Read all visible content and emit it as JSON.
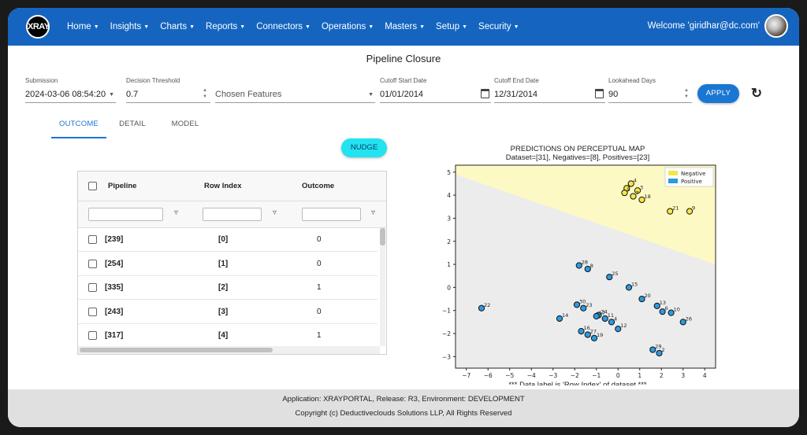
{
  "navbar": {
    "logo_text": "XRAY",
    "menu": [
      "Home",
      "Insights",
      "Charts",
      "Reports",
      "Connectors",
      "Operations",
      "Masters",
      "Setup",
      "Security"
    ],
    "welcome": "Welcome 'giridhar@dc.com'",
    "brand_color": "#1565c0"
  },
  "page": {
    "title": "Pipeline Closure"
  },
  "filters": {
    "submission": {
      "label": "Submission",
      "value": "2024-03-06 08:54:20"
    },
    "threshold": {
      "label": "Decision Threshold",
      "value": "0.7"
    },
    "features": {
      "placeholder": "Chosen Features"
    },
    "start_date": {
      "label": "Cutoff Start Date",
      "value": "01/01/2014"
    },
    "end_date": {
      "label": "Cutoff End Date",
      "value": "12/31/2014"
    },
    "lookahead": {
      "label": "Lookahead Days",
      "value": "90"
    },
    "apply_label": "APPLY"
  },
  "tabs": [
    {
      "label": "OUTCOME",
      "active": true
    },
    {
      "label": "DETAIL",
      "active": false
    },
    {
      "label": "MODEL",
      "active": false
    }
  ],
  "nudge_label": "NUDGE",
  "grid": {
    "columns": [
      "Pipeline",
      "Row Index",
      "Outcome"
    ],
    "rows": [
      {
        "pipeline": "[239]",
        "row_index": "[0]",
        "outcome": "0"
      },
      {
        "pipeline": "[254]",
        "row_index": "[1]",
        "outcome": "0"
      },
      {
        "pipeline": "[335]",
        "row_index": "[2]",
        "outcome": "1"
      },
      {
        "pipeline": "[243]",
        "row_index": "[3]",
        "outcome": "0"
      },
      {
        "pipeline": "[317]",
        "row_index": "[4]",
        "outcome": "1"
      }
    ]
  },
  "chart_data": {
    "type": "scatter",
    "title": "PREDICTIONS ON PERCEPTUAL MAP",
    "subtitle": "Dataset=[31], Negatives=[8], Positives=[23]",
    "xlabel": "*** Data label is 'Row Index' of dataset ***",
    "ylabel": "",
    "xlim": [
      -7.5,
      4.5
    ],
    "ylim": [
      -3.5,
      5.3
    ],
    "xticks": [
      -7,
      -6,
      -5,
      -4,
      -3,
      -2,
      -1,
      0,
      1,
      2,
      3,
      4
    ],
    "yticks": [
      -3,
      -2,
      -1,
      0,
      1,
      2,
      3,
      4,
      5
    ],
    "grid": false,
    "legend": "top-right",
    "boundary": {
      "x": [
        -7.5,
        4.5
      ],
      "y": [
        4.9,
        1.0
      ]
    },
    "series": [
      {
        "name": "Negative",
        "color": "#f2e64a",
        "region_color": "#fdf9c4",
        "points": [
          {
            "x": 0.4,
            "y": 4.3,
            "label": "1"
          },
          {
            "x": 0.6,
            "y": 4.5,
            "label": "4"
          },
          {
            "x": 0.3,
            "y": 4.1,
            "label": "5"
          },
          {
            "x": 0.9,
            "y": 4.2,
            "label": "3"
          },
          {
            "x": 0.7,
            "y": 3.95,
            "label": "7"
          },
          {
            "x": 1.1,
            "y": 3.8,
            "label": "18"
          },
          {
            "x": 2.4,
            "y": 3.3,
            "label": "21"
          },
          {
            "x": 3.3,
            "y": 3.3,
            "label": "9"
          }
        ]
      },
      {
        "name": "Positive",
        "color": "#2d9ae0",
        "region_color": "#ececec",
        "points": [
          {
            "x": -1.8,
            "y": 0.95,
            "label": "28"
          },
          {
            "x": -1.4,
            "y": 0.8,
            "label": "8"
          },
          {
            "x": -0.4,
            "y": 0.45,
            "label": "25"
          },
          {
            "x": 0.5,
            "y": 0.0,
            "label": "15"
          },
          {
            "x": 1.1,
            "y": -0.5,
            "label": "20"
          },
          {
            "x": -6.3,
            "y": -0.9,
            "label": "22"
          },
          {
            "x": -1.9,
            "y": -0.75,
            "label": "30"
          },
          {
            "x": -1.6,
            "y": -0.9,
            "label": "23"
          },
          {
            "x": -2.7,
            "y": -1.35,
            "label": "14"
          },
          {
            "x": -0.9,
            "y": -1.2,
            "label": "24"
          },
          {
            "x": -0.6,
            "y": -1.35,
            "label": "11"
          },
          {
            "x": -0.3,
            "y": -1.5,
            "label": "4"
          },
          {
            "x": 0.0,
            "y": -1.8,
            "label": "12"
          },
          {
            "x": 1.8,
            "y": -0.8,
            "label": "13"
          },
          {
            "x": 2.05,
            "y": -1.05,
            "label": "6"
          },
          {
            "x": 2.45,
            "y": -1.1,
            "label": "10"
          },
          {
            "x": 3.0,
            "y": -1.5,
            "label": "26"
          },
          {
            "x": -1.7,
            "y": -1.9,
            "label": "16"
          },
          {
            "x": -1.4,
            "y": -2.05,
            "label": "27"
          },
          {
            "x": -1.1,
            "y": -2.2,
            "label": "19"
          },
          {
            "x": 1.6,
            "y": -2.7,
            "label": "29"
          },
          {
            "x": 1.9,
            "y": -2.85,
            "label": "2"
          },
          {
            "x": -1.0,
            "y": -1.25,
            "label": "17"
          }
        ]
      }
    ]
  },
  "footer": {
    "line1": "Application: XRAYPORTAL, Release: R3, Environment: DEVELOPMENT",
    "line2": "Copyright (c) Deductiveclouds Solutions LLP, All Rights Reserved"
  }
}
